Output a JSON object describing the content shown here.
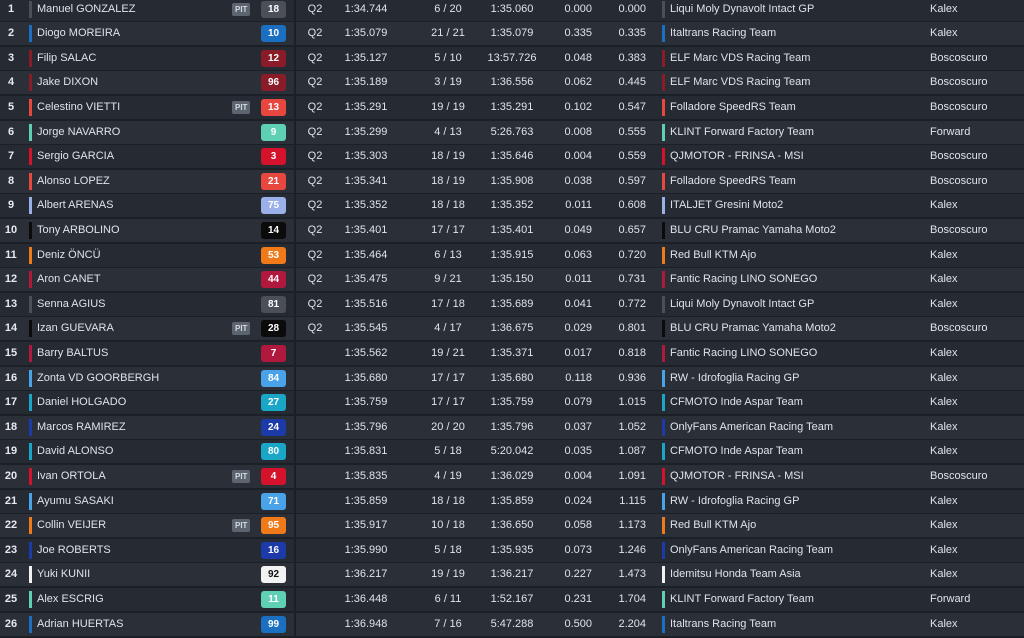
{
  "timing_table": {
    "pit_label": "PIT",
    "rows": [
      {
        "pos": "1",
        "rider": "Manuel GONZALEZ",
        "pit": true,
        "number": "18",
        "number_color": "#4a4f58",
        "number_text": "light_on_dark",
        "rider_color": "#4a4f58",
        "session": "Q2",
        "best_lap": "1:34.744",
        "laps": "6 / 20",
        "last_lap": "1:35.060",
        "gap": "0.000",
        "gap_first": "0.000",
        "team": "Liqui Moly Dynavolt Intact GP",
        "constructor": "Kalex",
        "team_color": "#4a4f58"
      },
      {
        "pos": "2",
        "rider": "Diogo MOREIRA",
        "pit": false,
        "number": "10",
        "number_color": "#1a6fc0",
        "rider_color": "#1a6fc0",
        "session": "Q2",
        "best_lap": "1:35.079",
        "laps": "21 / 21",
        "last_lap": "1:35.079",
        "gap": "0.335",
        "gap_first": "0.335",
        "team": "Italtrans Racing Team",
        "constructor": "Kalex",
        "team_color": "#1a6fc0"
      },
      {
        "pos": "3",
        "rider": "Filip SALAC",
        "pit": false,
        "number": "12",
        "number_color": "#8a1c2a",
        "rider_color": "#8a1c2a",
        "session": "Q2",
        "best_lap": "1:35.127",
        "laps": "5 / 10",
        "last_lap": "13:57.726",
        "gap": "0.048",
        "gap_first": "0.383",
        "team": "ELF Marc VDS Racing Team",
        "constructor": "Boscoscuro",
        "team_color": "#8a1c2a"
      },
      {
        "pos": "4",
        "rider": "Jake DIXON",
        "pit": false,
        "number": "96",
        "number_color": "#8a1c2a",
        "rider_color": "#8a1c2a",
        "session": "Q2",
        "best_lap": "1:35.189",
        "laps": "3 / 19",
        "last_lap": "1:36.556",
        "gap": "0.062",
        "gap_first": "0.445",
        "team": "ELF Marc VDS Racing Team",
        "constructor": "Boscoscuro",
        "team_color": "#8a1c2a"
      },
      {
        "pos": "5",
        "rider": "Celestino VIETTI",
        "pit": true,
        "number": "13",
        "number_color": "#e8473f",
        "rider_color": "#e8473f",
        "session": "Q2",
        "best_lap": "1:35.291",
        "laps": "19 / 19",
        "last_lap": "1:35.291",
        "gap": "0.102",
        "gap_first": "0.547",
        "team": "Folladore SpeedRS Team",
        "constructor": "Boscoscuro",
        "team_color": "#e8473f"
      },
      {
        "pos": "6",
        "rider": "Jorge NAVARRO",
        "pit": false,
        "number": "9",
        "number_color": "#5fd0b4",
        "rider_color": "#5fd0b4",
        "session": "Q2",
        "best_lap": "1:35.299",
        "laps": "4 / 13",
        "last_lap": "5:26.763",
        "gap": "0.008",
        "gap_first": "0.555",
        "team": "KLINT Forward Factory Team",
        "constructor": "Forward",
        "team_color": "#5fd0b4"
      },
      {
        "pos": "7",
        "rider": "Sergio GARCIA",
        "pit": false,
        "number": "3",
        "number_color": "#d4122c",
        "rider_color": "#d4122c",
        "session": "Q2",
        "best_lap": "1:35.303",
        "laps": "18 / 19",
        "last_lap": "1:35.646",
        "gap": "0.004",
        "gap_first": "0.559",
        "team": "QJMOTOR - FRINSA - MSI",
        "constructor": "Boscoscuro",
        "team_color": "#d4122c"
      },
      {
        "pos": "8",
        "rider": "Alonso LOPEZ",
        "pit": false,
        "number": "21",
        "number_color": "#e8473f",
        "rider_color": "#e8473f",
        "session": "Q2",
        "best_lap": "1:35.341",
        "laps": "18 / 19",
        "last_lap": "1:35.908",
        "gap": "0.038",
        "gap_first": "0.597",
        "team": "Folladore SpeedRS Team",
        "constructor": "Boscoscuro",
        "team_color": "#e8473f"
      },
      {
        "pos": "9",
        "rider": "Albert ARENAS",
        "pit": false,
        "number": "75",
        "number_color": "#9bb0e8",
        "rider_color": "#9bb0e8",
        "session": "Q2",
        "best_lap": "1:35.352",
        "laps": "18 / 18",
        "last_lap": "1:35.352",
        "gap": "0.011",
        "gap_first": "0.608",
        "team": "ITALJET Gresini Moto2",
        "constructor": "Kalex",
        "team_color": "#9bb0e8"
      },
      {
        "pos": "10",
        "rider": "Tony ARBOLINO",
        "pit": false,
        "number": "14",
        "number_color": "#0b0b0b",
        "rider_color": "#0b0b0b",
        "session": "Q2",
        "best_lap": "1:35.401",
        "laps": "17 / 17",
        "last_lap": "1:35.401",
        "gap": "0.049",
        "gap_first": "0.657",
        "team": "BLU CRU Pramac Yamaha Moto2",
        "constructor": "Boscoscuro",
        "team_color": "#0b0b0b"
      },
      {
        "pos": "11",
        "rider": "Deniz ÖNCÜ",
        "pit": false,
        "number": "53",
        "number_color": "#f07a1a",
        "rider_color": "#f07a1a",
        "session": "Q2",
        "best_lap": "1:35.464",
        "laps": "6 / 13",
        "last_lap": "1:35.915",
        "gap": "0.063",
        "gap_first": "0.720",
        "team": "Red Bull KTM Ajo",
        "constructor": "Kalex",
        "team_color": "#f07a1a"
      },
      {
        "pos": "12",
        "rider": "Aron CANET",
        "pit": false,
        "number": "44",
        "number_color": "#b0183e",
        "rider_color": "#b0183e",
        "session": "Q2",
        "best_lap": "1:35.475",
        "laps": "9 / 21",
        "last_lap": "1:35.150",
        "gap": "0.011",
        "gap_first": "0.731",
        "team": "Fantic Racing LINO SONEGO",
        "constructor": "Kalex",
        "team_color": "#b0183e"
      },
      {
        "pos": "13",
        "rider": "Senna AGIUS",
        "pit": false,
        "number": "81",
        "number_color": "#4a4f58",
        "rider_color": "#4a4f58",
        "session": "Q2",
        "best_lap": "1:35.516",
        "laps": "17 / 18",
        "last_lap": "1:35.689",
        "gap": "0.041",
        "gap_first": "0.772",
        "team": "Liqui Moly Dynavolt Intact GP",
        "constructor": "Kalex",
        "team_color": "#4a4f58"
      },
      {
        "pos": "14",
        "rider": "Izan GUEVARA",
        "pit": true,
        "number": "28",
        "number_color": "#0b0b0b",
        "rider_color": "#0b0b0b",
        "session": "Q2",
        "best_lap": "1:35.545",
        "laps": "4 / 17",
        "last_lap": "1:36.675",
        "gap": "0.029",
        "gap_first": "0.801",
        "team": "BLU CRU Pramac Yamaha Moto2",
        "constructor": "Boscoscuro",
        "team_color": "#0b0b0b"
      },
      {
        "pos": "15",
        "rider": "Barry BALTUS",
        "pit": false,
        "number": "7",
        "number_color": "#b0183e",
        "rider_color": "#b0183e",
        "session": "",
        "best_lap": "1:35.562",
        "laps": "19 / 21",
        "last_lap": "1:35.371",
        "gap": "0.017",
        "gap_first": "0.818",
        "team": "Fantic Racing LINO SONEGO",
        "constructor": "Kalex",
        "team_color": "#b0183e"
      },
      {
        "pos": "16",
        "rider": "Zonta VD GOORBERGH",
        "pit": false,
        "number": "84",
        "number_color": "#4aa3e8",
        "rider_color": "#4aa3e8",
        "session": "",
        "best_lap": "1:35.680",
        "laps": "17 / 17",
        "last_lap": "1:35.680",
        "gap": "0.118",
        "gap_first": "0.936",
        "team": "RW - Idrofoglia Racing GP",
        "constructor": "Kalex",
        "team_color": "#4aa3e8"
      },
      {
        "pos": "17",
        "rider": "Daniel HOLGADO",
        "pit": false,
        "number": "27",
        "number_color": "#1aa6c6",
        "rider_color": "#1aa6c6",
        "session": "",
        "best_lap": "1:35.759",
        "laps": "17 / 17",
        "last_lap": "1:35.759",
        "gap": "0.079",
        "gap_first": "1.015",
        "team": "CFMOTO Inde Aspar Team",
        "constructor": "Kalex",
        "team_color": "#1aa6c6"
      },
      {
        "pos": "18",
        "rider": "Marcos RAMIREZ",
        "pit": false,
        "number": "24",
        "number_color": "#1c3aa8",
        "rider_color": "#1c3aa8",
        "session": "",
        "best_lap": "1:35.796",
        "laps": "20 / 20",
        "last_lap": "1:35.796",
        "gap": "0.037",
        "gap_first": "1.052",
        "team": "OnlyFans American Racing Team",
        "constructor": "Kalex",
        "team_color": "#1c3aa8"
      },
      {
        "pos": "19",
        "rider": "David ALONSO",
        "pit": false,
        "number": "80",
        "number_color": "#1aa6c6",
        "rider_color": "#1aa6c6",
        "session": "",
        "best_lap": "1:35.831",
        "laps": "5 / 18",
        "last_lap": "5:20.042",
        "gap": "0.035",
        "gap_first": "1.087",
        "team": "CFMOTO Inde Aspar Team",
        "constructor": "Kalex",
        "team_color": "#1aa6c6"
      },
      {
        "pos": "20",
        "rider": "Ivan ORTOLA",
        "pit": true,
        "number": "4",
        "number_color": "#d4122c",
        "rider_color": "#d4122c",
        "session": "",
        "best_lap": "1:35.835",
        "laps": "4 / 19",
        "last_lap": "1:36.029",
        "gap": "0.004",
        "gap_first": "1.091",
        "team": "QJMOTOR - FRINSA - MSI",
        "constructor": "Boscoscuro",
        "team_color": "#d4122c"
      },
      {
        "pos": "21",
        "rider": "Ayumu SASAKI",
        "pit": false,
        "number": "71",
        "number_color": "#4aa3e8",
        "rider_color": "#4aa3e8",
        "session": "",
        "best_lap": "1:35.859",
        "laps": "18 / 18",
        "last_lap": "1:35.859",
        "gap": "0.024",
        "gap_first": "1.115",
        "team": "RW - Idrofoglia Racing GP",
        "constructor": "Kalex",
        "team_color": "#4aa3e8"
      },
      {
        "pos": "22",
        "rider": "Collin VEIJER",
        "pit": true,
        "number": "95",
        "number_color": "#f07a1a",
        "rider_color": "#f07a1a",
        "session": "",
        "best_lap": "1:35.917",
        "laps": "10 / 18",
        "last_lap": "1:36.650",
        "gap": "0.058",
        "gap_first": "1.173",
        "team": "Red Bull KTM Ajo",
        "constructor": "Kalex",
        "team_color": "#f07a1a"
      },
      {
        "pos": "23",
        "rider": "Joe ROBERTS",
        "pit": false,
        "number": "16",
        "number_color": "#1c3aa8",
        "rider_color": "#1c3aa8",
        "session": "",
        "best_lap": "1:35.990",
        "laps": "5 / 18",
        "last_lap": "1:35.935",
        "gap": "0.073",
        "gap_first": "1.246",
        "team": "OnlyFans American Racing Team",
        "constructor": "Kalex",
        "team_color": "#1c3aa8"
      },
      {
        "pos": "24",
        "rider": "Yuki KUNII",
        "pit": false,
        "number": "92",
        "number_color": "#f2f2f2",
        "rider_color": "#f2f2f2",
        "session": "",
        "best_lap": "1:36.217",
        "laps": "19 / 19",
        "last_lap": "1:36.217",
        "gap": "0.227",
        "gap_first": "1.473",
        "team": "Idemitsu Honda Team Asia",
        "constructor": "Kalex",
        "team_color": "#f2f2f2"
      },
      {
        "pos": "25",
        "rider": "Alex ESCRIG",
        "pit": false,
        "number": "11",
        "number_color": "#5fd0b4",
        "rider_color": "#5fd0b4",
        "session": "",
        "best_lap": "1:36.448",
        "laps": "6 / 11",
        "last_lap": "1:52.167",
        "gap": "0.231",
        "gap_first": "1.704",
        "team": "KLINT Forward Factory Team",
        "constructor": "Forward",
        "team_color": "#5fd0b4"
      },
      {
        "pos": "26",
        "rider": "Adrian HUERTAS",
        "pit": false,
        "number": "99",
        "number_color": "#1a6fc0",
        "rider_color": "#1a6fc0",
        "session": "",
        "best_lap": "1:36.948",
        "laps": "7 / 16",
        "last_lap": "5:47.288",
        "gap": "0.500",
        "gap_first": "2.204",
        "team": "Italtrans Racing Team",
        "constructor": "Kalex",
        "team_color": "#1a6fc0"
      }
    ]
  }
}
